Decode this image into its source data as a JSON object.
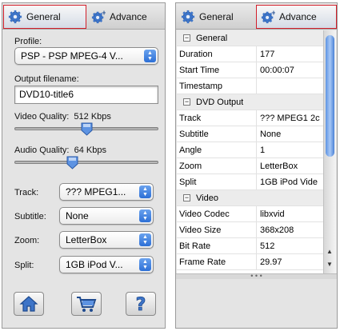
{
  "left": {
    "tabs": {
      "general": "General",
      "advance": "Advance"
    },
    "profile_label": "Profile:",
    "profile_value": "PSP - PSP MPEG-4 V...",
    "output_label": "Output filename:",
    "output_value": "DVD10-title6",
    "video_quality_label": "Video Quality:",
    "video_quality_value": "512 Kbps",
    "video_quality_level": 0.5,
    "audio_quality_label": "Audio Quality:",
    "audio_quality_value": "64 Kbps",
    "audio_quality_level": 0.4,
    "track_label": "Track:",
    "track_value": "??? MPEG1...",
    "subtitle_label": "Subtitle:",
    "subtitle_value": "None",
    "zoom_label": "Zoom:",
    "zoom_value": "LetterBox",
    "split_label": "Split:",
    "split_value": "1GB iPod V...",
    "buttons": [
      "home-icon",
      "cart-icon",
      "help-icon"
    ]
  },
  "right": {
    "tabs": {
      "general": "General",
      "advance": "Advance"
    },
    "rows": [
      {
        "type": "cat",
        "key": "General",
        "toggle": "−"
      },
      {
        "type": "prop",
        "key": "Duration",
        "value": "177"
      },
      {
        "type": "prop",
        "key": "Start Time",
        "value": "00:00:07"
      },
      {
        "type": "prop",
        "key": "Timestamp",
        "value": ""
      },
      {
        "type": "cat",
        "key": "DVD Output",
        "toggle": "−"
      },
      {
        "type": "prop",
        "key": "Track",
        "value": "??? MPEG1 2c"
      },
      {
        "type": "prop",
        "key": "Subtitle",
        "value": "None"
      },
      {
        "type": "prop",
        "key": "Angle",
        "value": "1"
      },
      {
        "type": "prop",
        "key": "Zoom",
        "value": "LetterBox"
      },
      {
        "type": "prop",
        "key": "Split",
        "value": "1GB iPod Vide"
      },
      {
        "type": "cat",
        "key": "Video",
        "toggle": "−"
      },
      {
        "type": "prop",
        "key": "Video Codec",
        "value": "libxvid"
      },
      {
        "type": "prop",
        "key": "Video Size",
        "value": "368x208"
      },
      {
        "type": "prop",
        "key": "Bit Rate",
        "value": "512"
      },
      {
        "type": "prop",
        "key": "Frame Rate",
        "value": "29.97"
      }
    ],
    "splitter_glyph": "• • •"
  },
  "colors": {
    "selected_tab_border": "#d21f2a",
    "accent_blue": "#2c6fd6"
  }
}
